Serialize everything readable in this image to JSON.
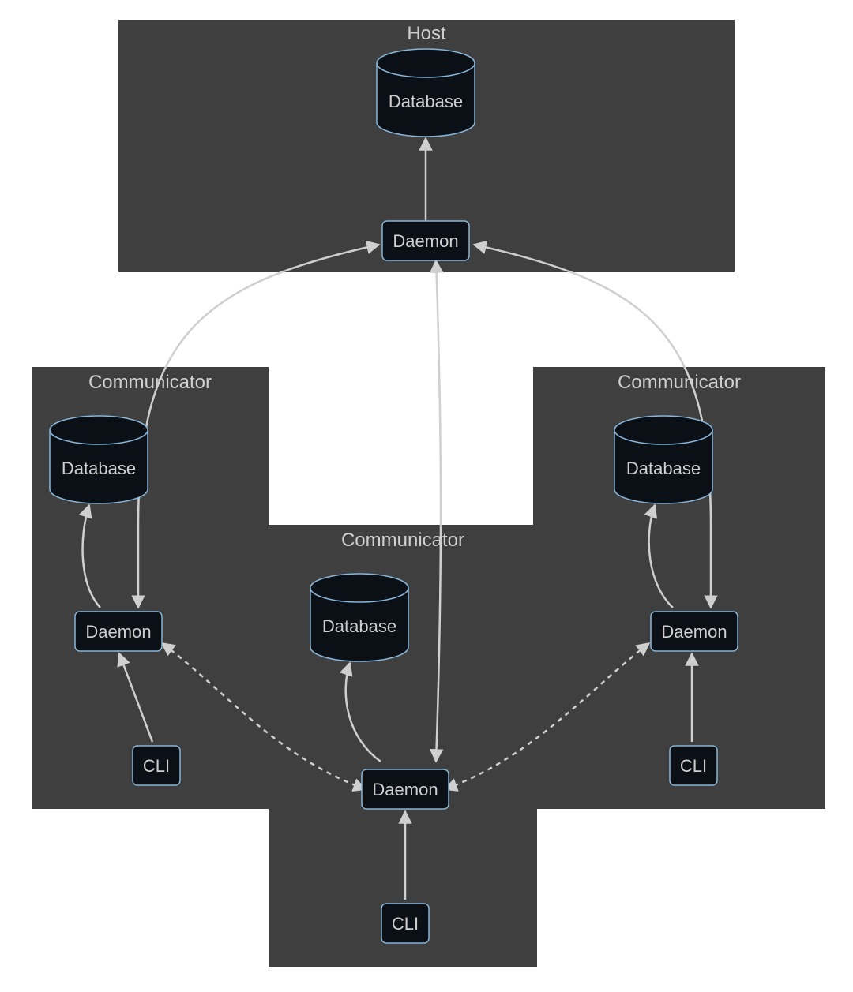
{
  "diagram": {
    "groups": {
      "host": {
        "title": "Host"
      },
      "comm_left": {
        "title": "Communicator"
      },
      "comm_mid": {
        "title": "Communicator"
      },
      "comm_right": {
        "title": "Communicator"
      }
    },
    "nodes": {
      "host_db": {
        "label": "Database"
      },
      "host_daemon": {
        "label": "Daemon"
      },
      "left_db": {
        "label": "Database"
      },
      "left_daemon": {
        "label": "Daemon"
      },
      "left_cli": {
        "label": "CLI"
      },
      "mid_db": {
        "label": "Database"
      },
      "mid_daemon": {
        "label": "Daemon"
      },
      "mid_cli": {
        "label": "CLI"
      },
      "right_db": {
        "label": "Database"
      },
      "right_daemon": {
        "label": "Daemon"
      },
      "right_cli": {
        "label": "CLI"
      }
    },
    "edges": [
      {
        "from": "host_daemon",
        "to": "host_db",
        "style": "solid",
        "bidirectional": false
      },
      {
        "from": "left_daemon",
        "to": "left_db",
        "style": "solid",
        "bidirectional": false
      },
      {
        "from": "mid_daemon",
        "to": "mid_db",
        "style": "solid",
        "bidirectional": false
      },
      {
        "from": "right_daemon",
        "to": "right_db",
        "style": "solid",
        "bidirectional": false
      },
      {
        "from": "left_cli",
        "to": "left_daemon",
        "style": "solid",
        "bidirectional": false
      },
      {
        "from": "mid_cli",
        "to": "mid_daemon",
        "style": "solid",
        "bidirectional": false
      },
      {
        "from": "right_cli",
        "to": "right_daemon",
        "style": "solid",
        "bidirectional": false
      },
      {
        "from": "left_daemon",
        "to": "host_daemon",
        "style": "solid",
        "bidirectional": true
      },
      {
        "from": "mid_daemon",
        "to": "host_daemon",
        "style": "solid",
        "bidirectional": true
      },
      {
        "from": "right_daemon",
        "to": "host_daemon",
        "style": "solid",
        "bidirectional": true
      },
      {
        "from": "mid_daemon",
        "to": "left_daemon",
        "style": "dotted",
        "bidirectional": true
      },
      {
        "from": "mid_daemon",
        "to": "right_daemon",
        "style": "dotted",
        "bidirectional": true
      }
    ]
  }
}
